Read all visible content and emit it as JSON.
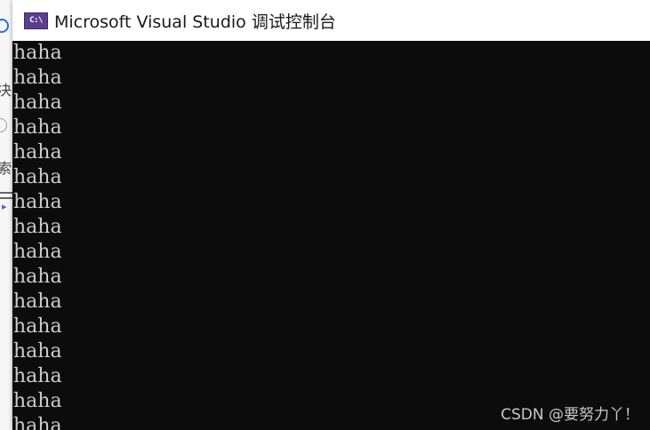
{
  "background_window": {
    "fragments": [
      "决",
      "索"
    ]
  },
  "console": {
    "app_icon_text": "C:\\",
    "title": "Microsoft Visual Studio 调试控制台",
    "lines": [
      "haha",
      "haha",
      "haha",
      "haha",
      "haha",
      "haha",
      "haha",
      "haha",
      "haha",
      "haha",
      "haha",
      "haha",
      "haha",
      "haha",
      "haha",
      "haha"
    ],
    "text_color": "#cccccc",
    "background_color": "#0c0c0c"
  },
  "watermark": {
    "text": "CSDN @要努力丫！"
  }
}
